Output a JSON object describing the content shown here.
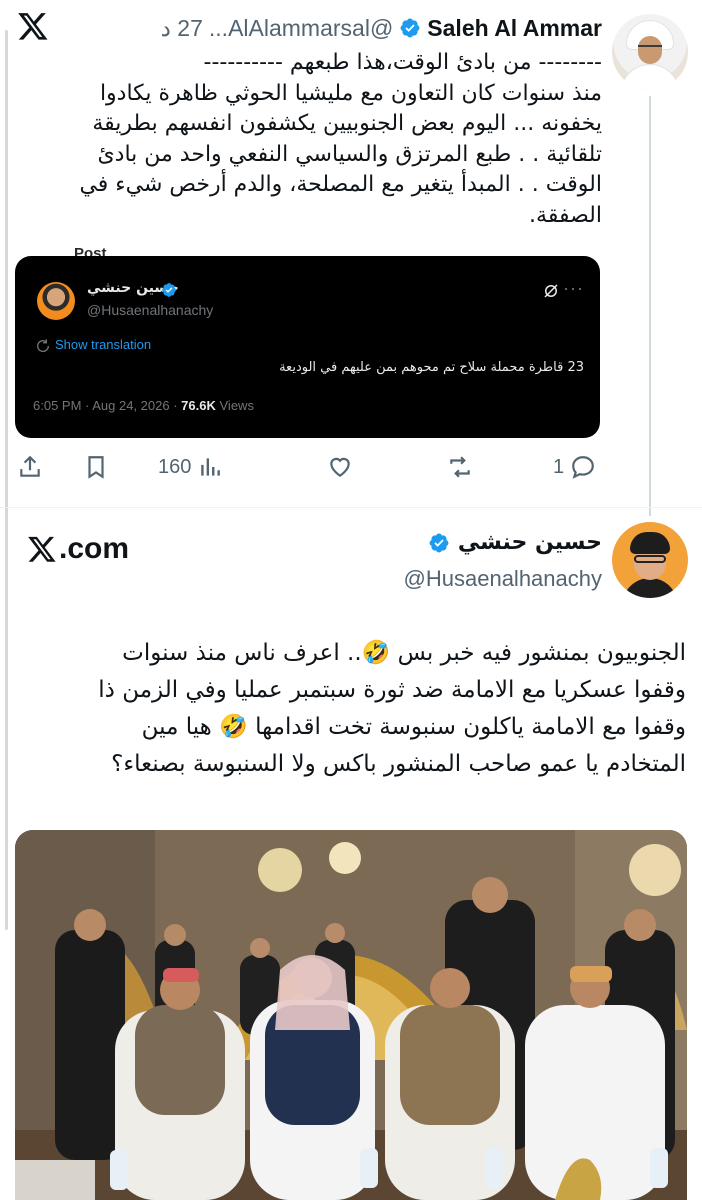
{
  "top_tweet": {
    "name": "Saleh Al Ammar",
    "handle": "@AlAlammarsal...",
    "time": "27 د",
    "lines": [
      "-------- من بادئ الوقت،هذا طبعهم ----------",
      "منذ سنوات كان التعاون مع مليشيا الحوثي ظاهرة يكادوا",
      "يخفونه ... اليوم بعض الجنوبيين  يكشفون انفسهم بطريقة",
      "تلقائية . . طبع المرتزق والسياسي النفعي واحد من بادئ",
      "الوقت . . المبدأ يتغير مع المصلحة، والدم أرخص شيء في",
      "الصفقة."
    ],
    "quoted": {
      "header_fragment": "Post",
      "name": "حسين حنشي",
      "handle": "@Husaenalhanachy",
      "more": "···",
      "show_translation": "Show translation",
      "text": "23 قاطرة محملة سلاح تم محوهم بمن عليهم في الوديعة",
      "timestamp": "6:05 PM · Aug 24, 2026 ·",
      "views_count": "76.6K",
      "views_label": "Views"
    },
    "actions": {
      "replies": "1",
      "views": "160"
    }
  },
  "bottom_tweet": {
    "site": ".com",
    "name": "حسين حنشي",
    "handle": "@Husaenalhanachy",
    "lines": [
      "الجنوبيون بمنشور فيه خبر بس 🤣.. اعرف ناس منذ سنوات",
      "وقفوا عسكريا مع الامامة ضد ثورة سبتمبر عمليا وفي الزمن ذا",
      "وقفوا مع الامامة ياكلون سنبوسة تخت اقدامها 🤣 هيا مين",
      "المتخادم يا عمو صاحب المنشور باكس ولا السنبوسة بصنعاء؟"
    ]
  },
  "colors": {
    "verified": "#1d9bf0",
    "secondary_text": "#536471",
    "link": "#1d9bf0",
    "quote_bg": "#000000"
  }
}
